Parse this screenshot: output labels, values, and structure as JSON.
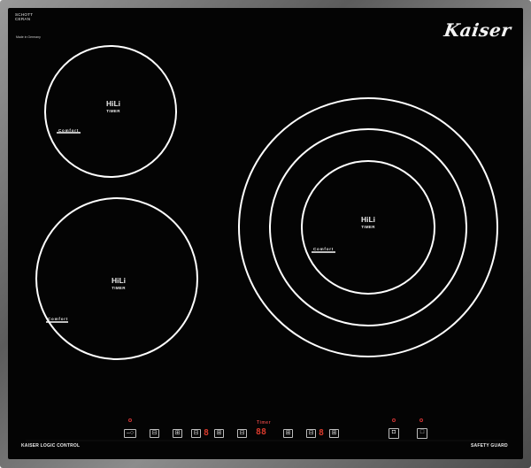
{
  "panel": {
    "manufacturer": "SCHOTT\nCERAN",
    "made_in": "Made in Germany",
    "logo": "Kaiser"
  },
  "zones": [
    {
      "title": "HiLi",
      "subtitle": "TIMER",
      "mode": "Comfort"
    },
    {
      "title": "HiLi",
      "subtitle": "TIMER",
      "mode": "Comfort"
    },
    {
      "title": "HiLi",
      "subtitle": "TIMER",
      "mode": "Comfort"
    }
  ],
  "controls": {
    "left_label": "KAISER LOGIC CONTROL",
    "right_label": "SAFETY GUARD",
    "timer_label": "Timer",
    "display_zone_1": "8",
    "display_timer": "88",
    "display_zone_2": "8",
    "buttons": [
      {
        "name": "power-zone-button",
        "glyph": "–○"
      },
      {
        "name": "minus-button",
        "glyph": "⊟"
      },
      {
        "name": "plus-button",
        "glyph": "⊞"
      },
      {
        "name": "minus-button",
        "glyph": "⊟"
      },
      {
        "name": "plus-button",
        "glyph": "⊞"
      },
      {
        "name": "timer-minus-button",
        "glyph": "⊟"
      },
      {
        "name": "timer-plus-button",
        "glyph": "⊞"
      },
      {
        "name": "minus-button",
        "glyph": "⊟"
      },
      {
        "name": "plus-button",
        "glyph": "⊞"
      },
      {
        "name": "lock-button",
        "glyph": "◘"
      },
      {
        "name": "power-button",
        "glyph": "□"
      }
    ]
  },
  "colors": {
    "glass": "#040404",
    "frame": "#8a8a8a",
    "ring": "#ffffff",
    "display_led": "#d83a2c"
  }
}
